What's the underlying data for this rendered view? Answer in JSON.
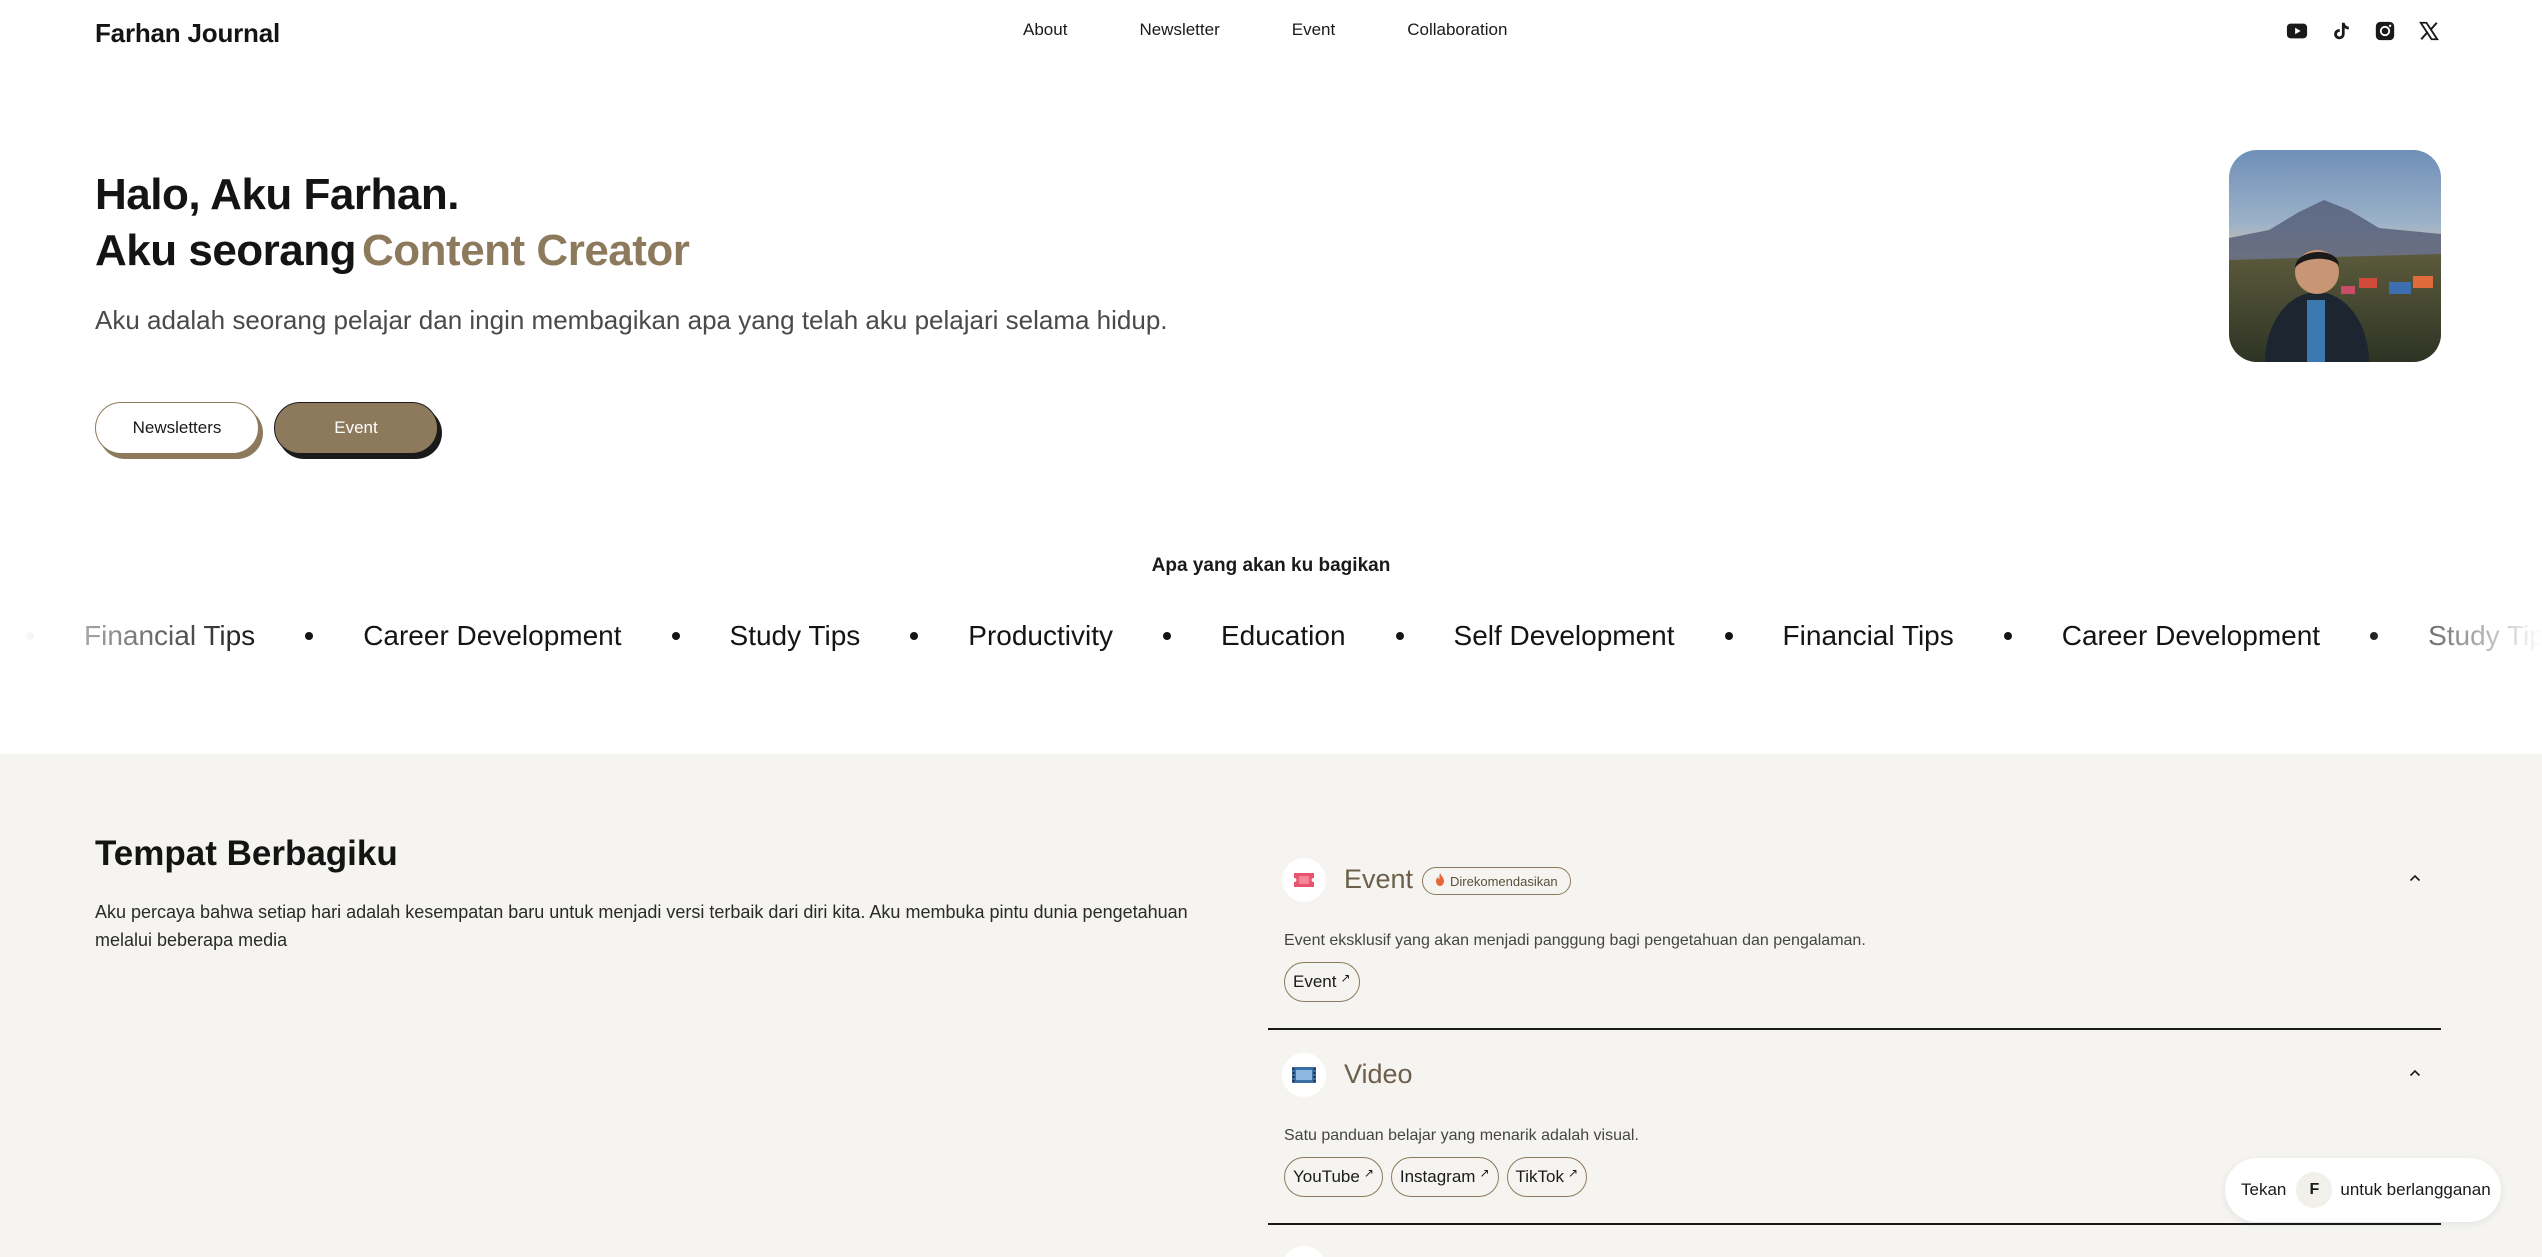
{
  "header": {
    "brand": "Farhan Journal",
    "nav": [
      "About",
      "Newsletter",
      "Event",
      "Collaboration"
    ],
    "socials": [
      "youtube-icon",
      "tiktok-icon",
      "instagram-icon",
      "x-icon"
    ]
  },
  "hero": {
    "line1": "Halo, Aku Farhan.",
    "line2_prefix": "Aku seorang",
    "line2_accent": "Content Creator",
    "description": "Aku adalah seorang pelajar dan ingin membagikan apa yang telah aku pelajari selama hidup.",
    "buttons": {
      "newsletters": "Newsletters",
      "event": "Event"
    }
  },
  "topics": {
    "title": "Apa yang akan ku bagikan",
    "items": [
      "Financial Tips",
      "Career Development",
      "Study Tips",
      "Productivity",
      "Education",
      "Self Development",
      "Financial Tips",
      "Career Development",
      "Study Tips"
    ]
  },
  "sharing": {
    "title": "Tempat Berbagiku",
    "description": "Aku percaya bahwa setiap hari adalah kesempatan baru untuk menjadi versi terbaik dari diri kita. Aku membuka pintu dunia pengetahuan melalui beberapa media",
    "sections": [
      {
        "title": "Event",
        "badge": "Direkomendasikan",
        "text": "Event eksklusif yang akan menjadi panggung bagi pengetahuan dan pengalaman.",
        "links": [
          "Event"
        ]
      },
      {
        "title": "Video",
        "text": "Satu panduan belajar yang menarik adalah visual.",
        "links": [
          "YouTube",
          "Instagram",
          "TikTok"
        ]
      }
    ]
  },
  "subscribe": {
    "prefix": "Tekan",
    "key": "F",
    "suffix": "untuk berlangganan"
  },
  "colors": {
    "accent": "#8d7a5c",
    "accent_dark": "#6d5f49",
    "section_bg": "#f5f4f0",
    "text": "#141414"
  }
}
